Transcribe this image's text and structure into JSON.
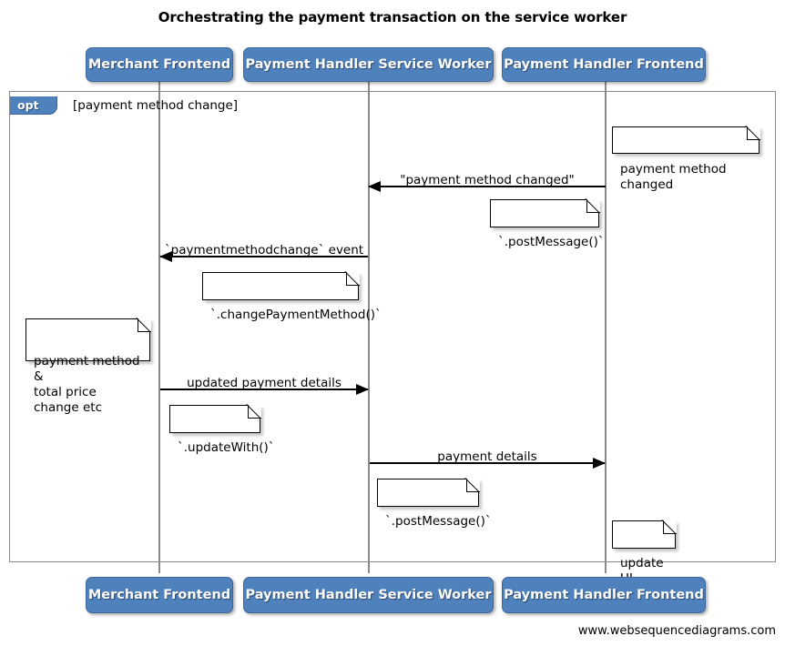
{
  "title": "Orchestrating the payment transaction on the service worker",
  "footer": "www.websequencediagrams.com",
  "colors": {
    "participant_fill": "#4F81BD",
    "participant_text": "#FFFFFF",
    "frame_border": "#8A8A8A",
    "note_fill": "#FFFFFF",
    "line": "#000000"
  },
  "participants": [
    {
      "name": "Merchant Frontend"
    },
    {
      "name": "Payment Handler Service Worker"
    },
    {
      "name": "Payment Handler Frontend"
    }
  ],
  "participants_bottom": [
    {
      "name": "Merchant Frontend"
    },
    {
      "name": "Payment Handler Service Worker"
    },
    {
      "name": "Payment Handler Frontend"
    }
  ],
  "fragment": {
    "type": "opt",
    "tag": "opt",
    "condition": "[payment method change]"
  },
  "messages": [
    {
      "id": "msg-payment-method-changed",
      "label": "\"payment method changed\"",
      "from": "Payment Handler Frontend",
      "to": "Payment Handler Service Worker",
      "direction": "left"
    },
    {
      "id": "msg-paymentmethodchange-event",
      "label": "`paymentmethodchange` event",
      "from": "Payment Handler Service Worker",
      "to": "Merchant Frontend",
      "direction": "left"
    },
    {
      "id": "msg-updated-payment-details",
      "label": "updated payment details",
      "from": "Merchant Frontend",
      "to": "Payment Handler Service Worker",
      "direction": "right"
    },
    {
      "id": "msg-payment-details",
      "label": "payment details",
      "from": "Payment Handler Service Worker",
      "to": "Payment Handler Frontend",
      "direction": "right"
    }
  ],
  "notes": [
    {
      "id": "note-payment-method-changed",
      "text": "payment method changed"
    },
    {
      "id": "note-post-message-1",
      "text": "`.postMessage()`"
    },
    {
      "id": "note-change-payment-method",
      "text": "`.changePaymentMethod()`"
    },
    {
      "id": "note-payment-method-total-price",
      "text": "payment method &\ntotal price change etc"
    },
    {
      "id": "note-update-with",
      "text": "`.updateWith()`"
    },
    {
      "id": "note-post-message-2",
      "text": "`.postMessage()`"
    },
    {
      "id": "note-update-ui",
      "text": "update UI"
    }
  ]
}
